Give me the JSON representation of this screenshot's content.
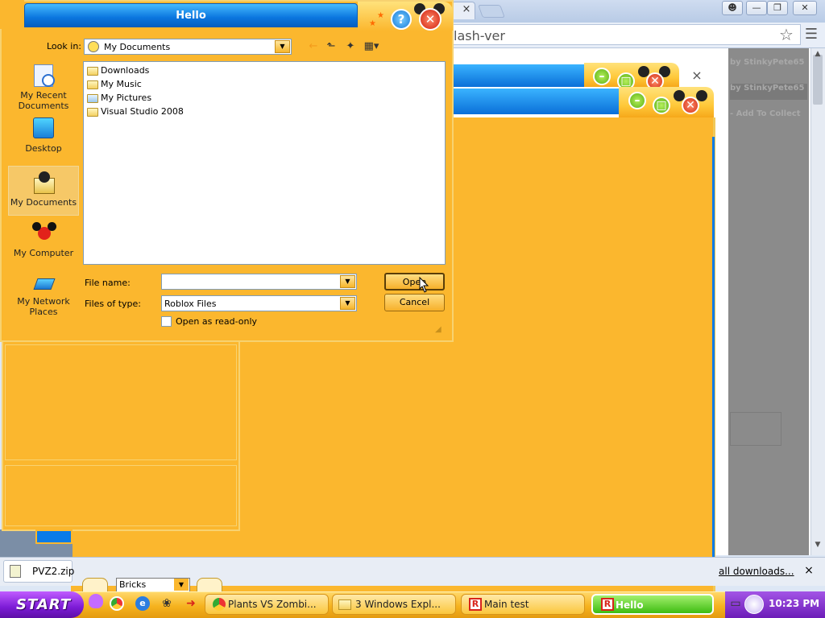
{
  "dialog": {
    "title": "Hello",
    "help_label": "?",
    "close_label": "✕",
    "look_in_label": "Look in:",
    "look_in_value": "My Documents",
    "places": [
      {
        "line1": "My Recent",
        "line2": "Documents"
      },
      {
        "line1": "Desktop",
        "line2": ""
      },
      {
        "line1": "My Documents",
        "line2": ""
      },
      {
        "line1": "My Computer",
        "line2": ""
      },
      {
        "line1": "My Network",
        "line2": "Places"
      }
    ],
    "files": [
      "Downloads",
      "My Music",
      "My Pictures",
      "Visual Studio 2008"
    ],
    "file_name_label": "File name:",
    "file_name_value": "",
    "file_type_label": "Files of type:",
    "file_type_value": "Roblox Files",
    "read_only_label": "Open as read-only",
    "open_label": "Open",
    "cancel_label": "Cancel"
  },
  "browser": {
    "tab_close": "×",
    "address_text": "lash-ver",
    "side_lines": [
      "by StinkyPete65",
      "by StinkyPete65",
      "- Add To Collect"
    ],
    "page_close": "×"
  },
  "background": {
    "bricks_label": "Bricks"
  },
  "downloads_bar": {
    "file_name": "PVZ2.zip",
    "all_downloads_label": "all downloads...",
    "close_label": "×"
  },
  "taskbar": {
    "start_label": "START",
    "tasks": [
      "Plants VS Zombi...",
      "3 Windows Expl...",
      "Main test",
      "Hello"
    ],
    "clock": "10:23 PM"
  },
  "colors": {
    "orange": "#fbb72e",
    "blue_title": "#0b76df",
    "start_purple": "#7c1bd6",
    "active_task_green": "#3ebc12"
  }
}
